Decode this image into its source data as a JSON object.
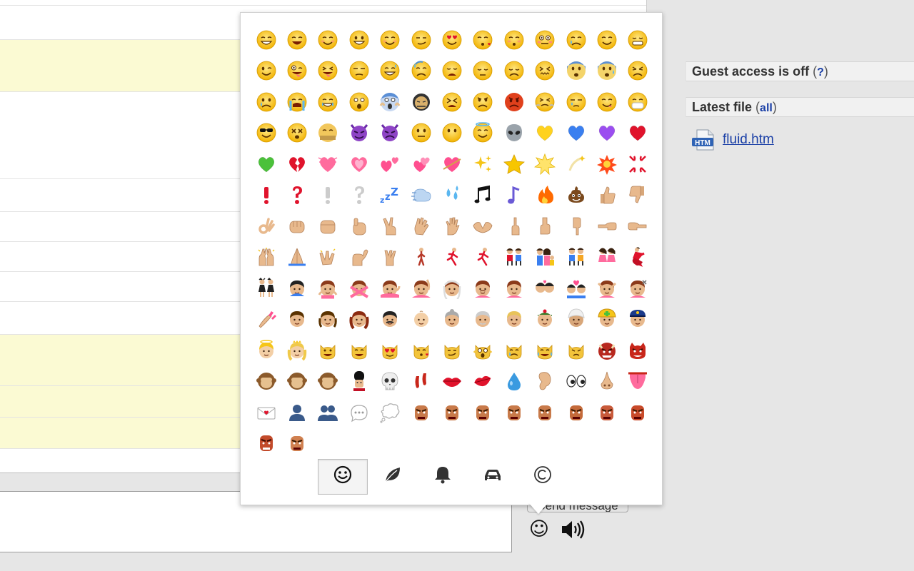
{
  "sidebar": {
    "guest_access_text": "Guest access is off",
    "guest_help_open": "(",
    "guest_help_link": "?",
    "guest_help_close": ")",
    "latest_file_title": "Latest file",
    "latest_file_open": "(",
    "latest_file_link": "all",
    "latest_file_close": ")",
    "file_icon_text": "HTM",
    "file_name": "fluid.htm"
  },
  "composer": {
    "send_label": "Send message",
    "emoji_glyph": "☺"
  },
  "emoji_picker": {
    "tabs": [
      {
        "icon": "smiley-icon",
        "glyph": "☺",
        "active": true
      },
      {
        "icon": "leaf-icon",
        "glyph": "🍃",
        "active": false
      },
      {
        "icon": "bell-icon",
        "glyph": "🔔",
        "active": false
      },
      {
        "icon": "car-icon",
        "glyph": "🚗",
        "active": false
      },
      {
        "icon": "copyright-icon",
        "glyph": "©",
        "active": false
      }
    ],
    "emoji_names": [
      "smile",
      "laughing",
      "blush",
      "smiley",
      "relaxed",
      "smirk",
      "heart-eyes",
      "kissing-heart",
      "kissing-closed-eyes",
      "flushed",
      "relieved",
      "satisfied",
      "grin",
      "wink",
      "stuck-out-tongue-winking-eye",
      "stuck-out-tongue-closed-eyes",
      "unamused",
      "sweat-smile",
      "sweat",
      "weary",
      "pensive",
      "disappointed",
      "confounded",
      "fearful",
      "cold-sweat",
      "persevere",
      "cry",
      "sob",
      "joy",
      "astonished",
      "scream",
      "tired-face",
      "angry",
      "rage",
      "triumph",
      "sleepy",
      "yum",
      "mask",
      "sunglasses",
      "dizzy-face",
      "imp",
      "smiling-imp",
      "neutral-face",
      "no-mouth",
      "innocent",
      "alien",
      "yellow-heart",
      "blue-heart",
      "purple-heart",
      "heart",
      "green-heart",
      "broken-heart",
      "heartbeat",
      "heartpulse",
      "two-hearts",
      "revolving-hearts",
      "cupid",
      "sparkling-heart",
      "sparkles",
      "star",
      "star2",
      "dizzy",
      "boom",
      "anger",
      "exclamation",
      "question",
      "grey-exclamation",
      "grey-question",
      "zzz",
      "dash",
      "sweat-drops",
      "notes",
      "musical-note",
      "fire",
      "poop",
      "thumbsup",
      "thumbsdown",
      "ok-hand",
      "punch",
      "fist",
      "v",
      "wave",
      "hand",
      "open-hands",
      "point-up",
      "point-down",
      "point-left",
      "point-right",
      "raised-hands",
      "pray",
      "point-up-2",
      "clap",
      "muscle",
      "metal",
      "walking",
      "runner",
      "couple",
      "family",
      "two-men",
      "two-women",
      "dancer",
      "dancers",
      "ok-woman",
      "no-good",
      "information-desk",
      "raising-hand",
      "bride-with-veil",
      "person-with-pouting-face",
      "person-frowning",
      "bow",
      "couplekiss",
      "couple-with-heart",
      "massage",
      "haircut",
      "nail-care",
      "boy",
      "girl",
      "woman",
      "man",
      "baby",
      "older-woman",
      "older-man",
      "person-with-blond-hair",
      "man-with-gua-pi-mao",
      "man-with-turban",
      "construction-worker",
      "cop",
      "angel",
      "princess",
      "smiley-cat",
      "smile-cat",
      "heart-eyes-cat",
      "kissing-cat",
      "smirk-cat",
      "scream-cat",
      "crying-cat-face",
      "joy-cat",
      "pouting-cat",
      "japanese-ogre",
      "japanese-goblin",
      "see-no-evil",
      "hear-no-evil",
      "speak-no-evil",
      "guardsman",
      "skull",
      "feet",
      "lips",
      "kiss",
      "droplet",
      "ear",
      "eyes",
      "nose",
      "tongue",
      "love-letter",
      "bust",
      "busts",
      "speech-balloon",
      "thought-balloon",
      "feelsgood",
      "finnadie",
      "goberserk",
      "godmode",
      "hurtrealbad",
      "rage1",
      "rage2",
      "rage3",
      "rage4",
      "suspect",
      "trollface",
      "shipit",
      "octocat"
    ]
  }
}
